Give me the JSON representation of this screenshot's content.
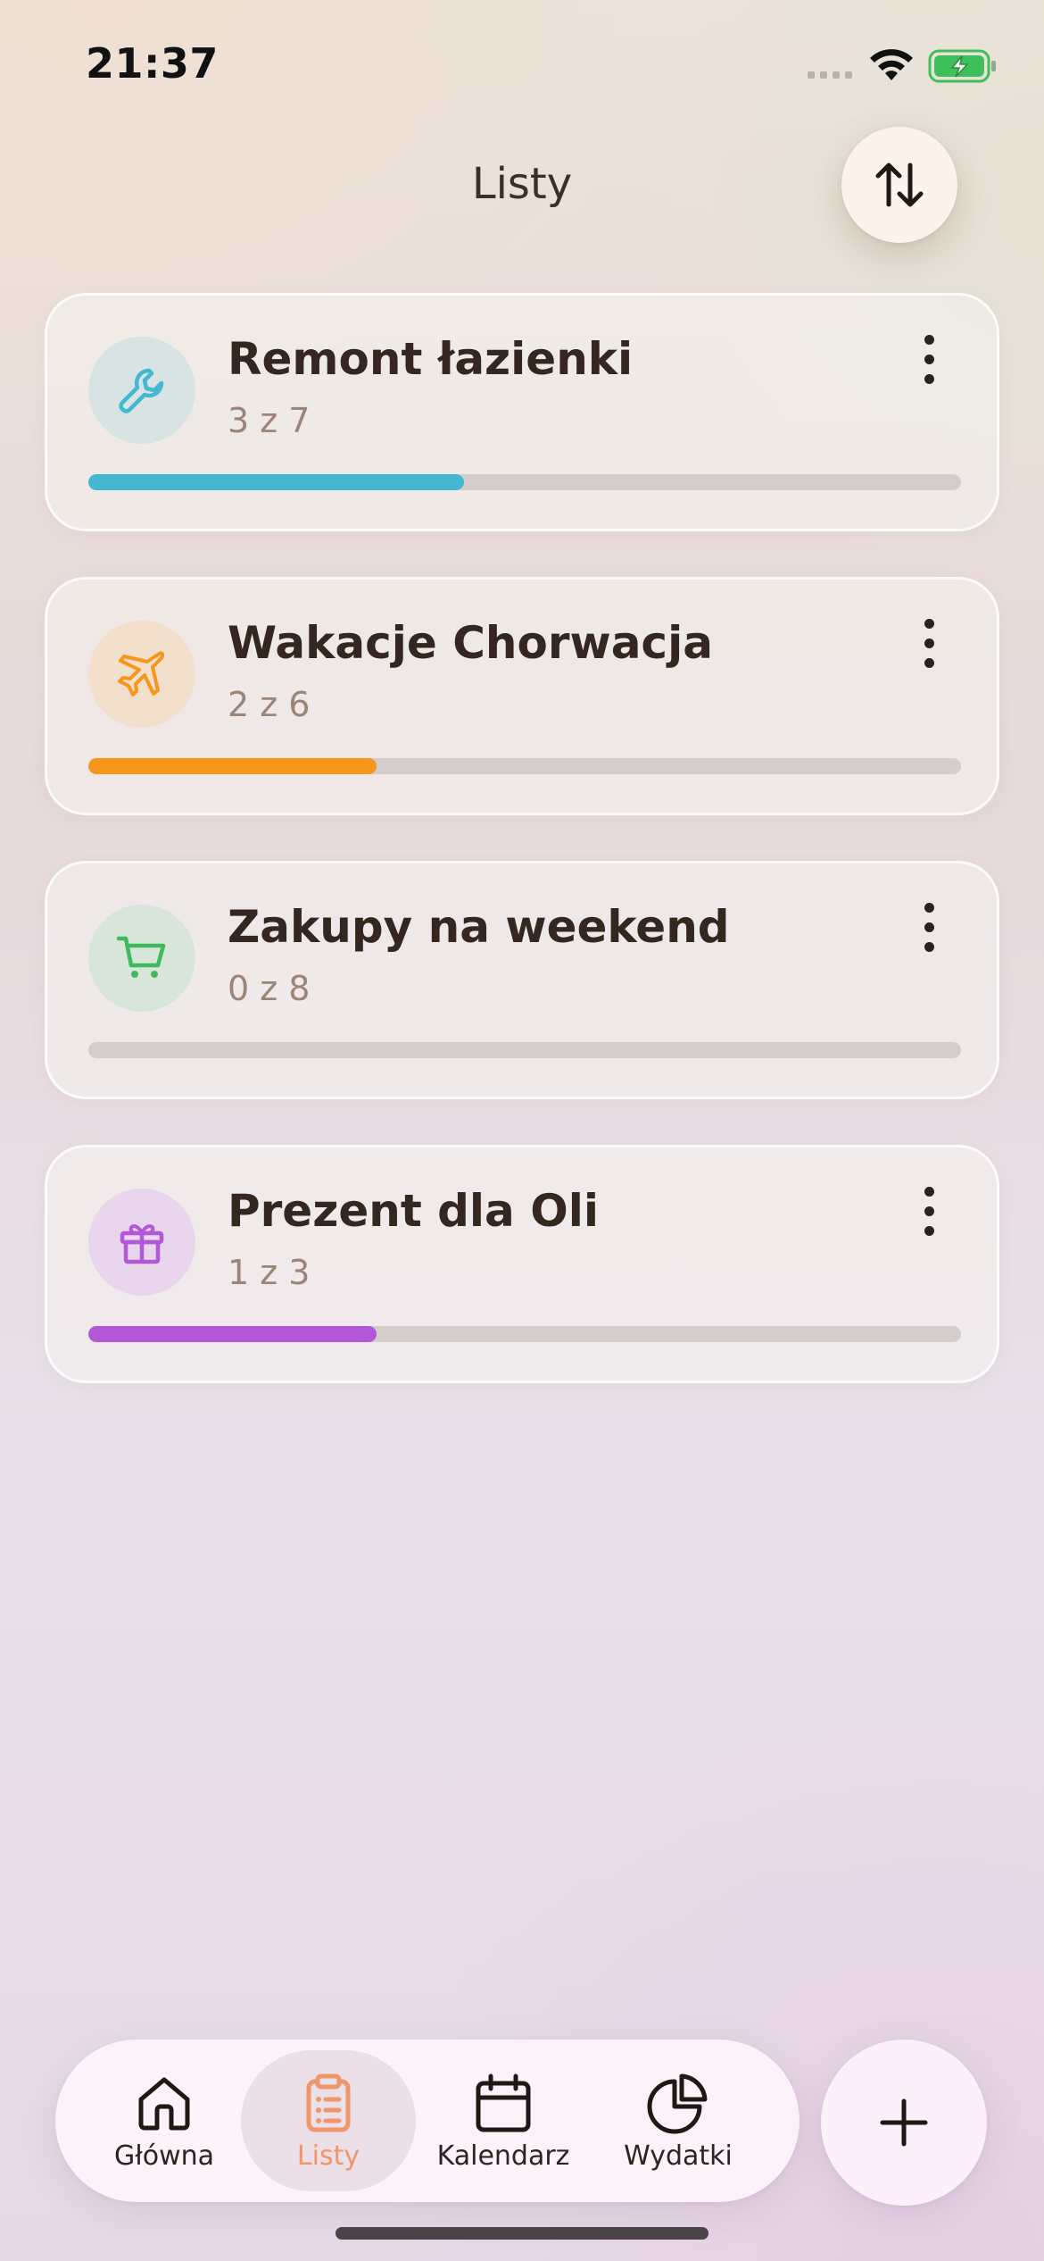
{
  "status_bar": {
    "time": "21:37"
  },
  "header": {
    "title": "Listy",
    "sort_icon": "sort-arrows-icon"
  },
  "lists": [
    {
      "title": "Remont łazienki",
      "count": "3 z 7",
      "progress": 0.43,
      "icon": "wrench-icon",
      "color": "#45b8d1",
      "icon_bg": "#d8e3e4"
    },
    {
      "title": "Wakacje Chorwacja",
      "count": "2 z 6",
      "progress": 0.33,
      "icon": "airplane-icon",
      "color": "#f7961b",
      "icon_bg": "#f2e0cc"
    },
    {
      "title": "Zakupy na weekend",
      "count": "0 z 8",
      "progress": 0,
      "icon": "cart-icon",
      "color": "#3dbb5c",
      "icon_bg": "#d8e6da"
    },
    {
      "title": "Prezent dla Oli",
      "count": "1 z 3",
      "progress": 0.33,
      "icon": "gift-icon",
      "color": "#b157d8",
      "icon_bg": "#e8d6ec"
    }
  ],
  "tab_bar": {
    "tabs": [
      {
        "label": "Główna",
        "icon": "home-icon",
        "active": false
      },
      {
        "label": "Listy",
        "icon": "clipboard-list-icon",
        "active": true
      },
      {
        "label": "Kalendarz",
        "icon": "calendar-icon",
        "active": false
      },
      {
        "label": "Wydatki",
        "icon": "pie-chart-icon",
        "active": false
      }
    ],
    "active_color": "#f0966a"
  },
  "fab": {
    "icon": "plus-icon"
  }
}
